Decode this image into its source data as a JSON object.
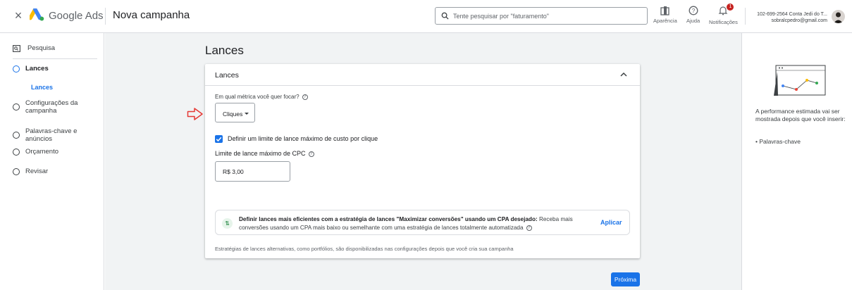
{
  "header": {
    "brand": "Google Ads",
    "campaign_title": "Nova campanha",
    "search_placeholder": "Tente pesquisar por \"faturamento\"",
    "tools": [
      {
        "label": "Aparência",
        "icon": "appearance-icon"
      },
      {
        "label": "Ajuda",
        "icon": "help-icon"
      },
      {
        "label": "Notificações",
        "icon": "bell-icon",
        "badge": "1"
      }
    ],
    "account_line1": "102-699-2564 Conta Jedi do T...",
    "account_line2": "sobralcpedro@gmail.com"
  },
  "sidebar": {
    "items": [
      {
        "label": "Pesquisa"
      },
      {
        "label": "Lances"
      },
      {
        "label": "Lances"
      },
      {
        "label": "Configurações da campanha"
      },
      {
        "label": "Palavras-chave e anúncios"
      },
      {
        "label": "Orçamento"
      },
      {
        "label": "Revisar"
      }
    ]
  },
  "main": {
    "page_title": "Lances",
    "card_title": "Lances",
    "metric_question": "Em qual métrica você quer focar?",
    "metric_value": "Cliques",
    "checkbox_label": "Definir um limite de lance máximo de custo por clique",
    "cpc_label": "Limite de lance máximo de CPC",
    "cpc_value": "R$ 3,00",
    "reco_bold": "Definir lances mais eficientes com a estratégia de lances \"Maximizar conversões\" usando um CPA desejado:",
    "reco_rest": " Receba mais conversões usando um CPA mais baixo ou semelhante com uma estratégia de lances totalmente automatizada",
    "reco_apply": "Aplicar",
    "footnote": "Estratégias de lances alternativas, como portfólios, são disponibilizadas nas configurações depois que você cria sua campanha",
    "next_label": "Próxima"
  },
  "right_panel": {
    "text": "A performance estimada vai ser mostrada depois que você inserir:",
    "bullet": "• Palavras-chave"
  },
  "colors": {
    "accent": "#1a73e8",
    "background": "#f1f3f4",
    "annotation_arrow": "#e53935"
  }
}
